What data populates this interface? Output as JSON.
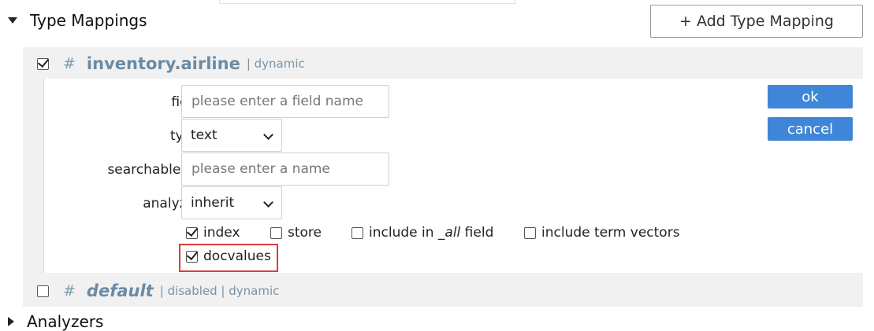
{
  "section": {
    "title": "Type Mappings",
    "add_button": "+ Add Type Mapping"
  },
  "mapping": {
    "name": "inventory.airline",
    "meta": "| dynamic",
    "hash": "#",
    "checked": true
  },
  "editor": {
    "field": {
      "label": "field",
      "placeholder": "please enter a field name"
    },
    "type": {
      "label": "type",
      "value": "text"
    },
    "searchable": {
      "label": "searchable as",
      "placeholder": "please enter a name"
    },
    "analyzer": {
      "label": "analyzer",
      "value": "inherit"
    },
    "options": [
      {
        "label": "index",
        "checked": true
      },
      {
        "label": "store",
        "checked": false
      },
      {
        "label_prefix": "include in ",
        "label_em": "_all",
        "label_suffix": " field",
        "checked": false
      },
      {
        "label": "include term vectors",
        "checked": false
      },
      {
        "label": "docvalues",
        "checked": true
      }
    ],
    "ok_button": "ok",
    "cancel_button": "cancel"
  },
  "default_mapping": {
    "name": "default",
    "meta": "| disabled | dynamic",
    "hash": "#",
    "checked": false
  },
  "next_section": {
    "title": "Analyzers"
  },
  "colors": {
    "accent": "#3f86d8",
    "highlight": "#e03a3a",
    "mapping_name": "#6b8aa3"
  }
}
